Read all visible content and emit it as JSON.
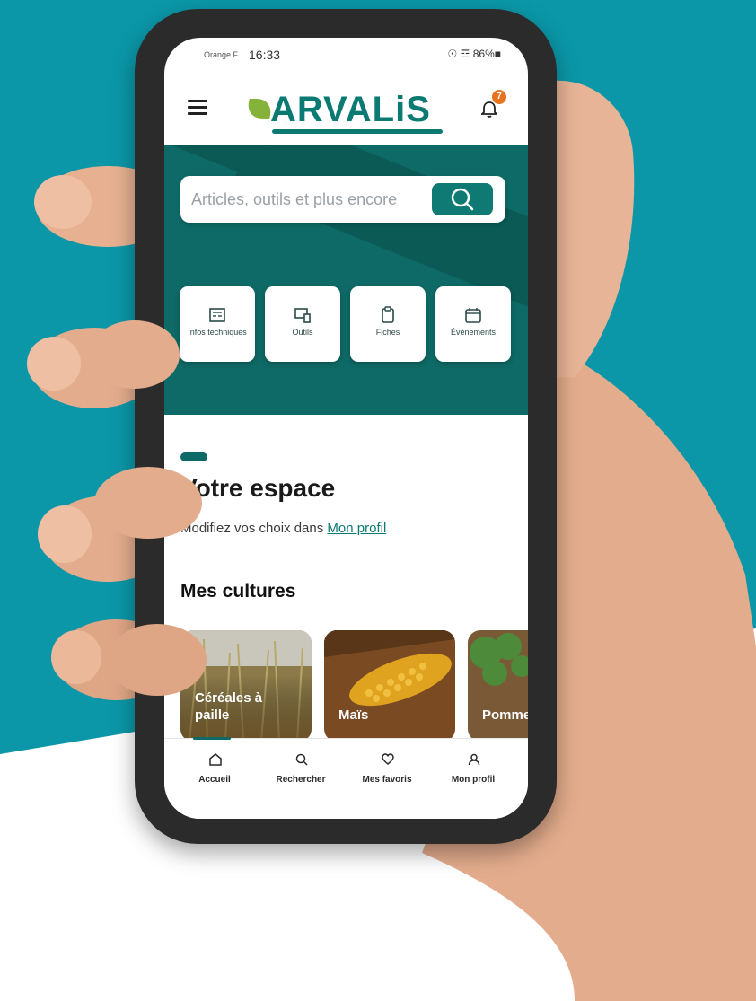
{
  "colors": {
    "background_teal": "#0b97a7",
    "brand_teal": "#0e6a66",
    "brand_green": "#85b33a",
    "notification_orange": "#e8731e"
  },
  "status_bar": {
    "operator": "Orange F",
    "time": "16:33",
    "system": "☉ ☲ 86%■"
  },
  "app_bar": {
    "logo_text": "ARVALiS",
    "notification_count": "7",
    "menu_icon": "hamburger-menu-icon",
    "bell_icon": "bell-icon"
  },
  "search": {
    "placeholder": "Articles, outils et plus encore",
    "icon": "search-icon"
  },
  "quick_links": [
    {
      "label": "Infos techniques",
      "icon": "news-icon"
    },
    {
      "label": "Outils",
      "icon": "device-icon"
    },
    {
      "label": "Fiches",
      "icon": "clipboard-icon"
    },
    {
      "label": "Événements",
      "icon": "calendar-icon"
    }
  ],
  "section": {
    "title": "Votre espace",
    "subtitle_prefix": "Modifiez vos choix dans ",
    "subtitle_link": "Mon profil",
    "cultures_title": "Mes cultures"
  },
  "crops": [
    {
      "label": "Céréales à paille"
    },
    {
      "label": "Maïs"
    },
    {
      "label": "Pomme de terre"
    }
  ],
  "tabs": [
    {
      "label": "Accueil",
      "icon": "home-icon",
      "active": true
    },
    {
      "label": "Rechercher",
      "icon": "search-icon",
      "active": false
    },
    {
      "label": "Mes favoris",
      "icon": "heart-icon",
      "active": false
    },
    {
      "label": "Mon profil",
      "icon": "user-icon",
      "active": false
    }
  ]
}
